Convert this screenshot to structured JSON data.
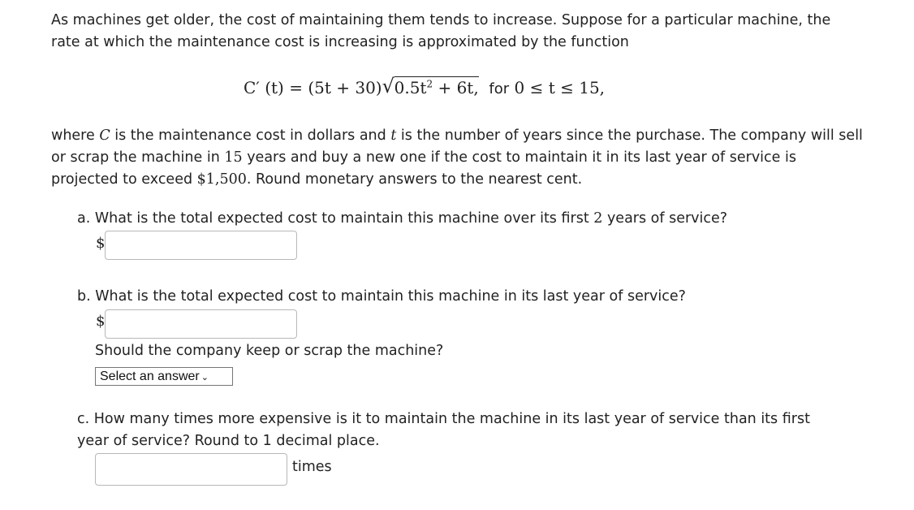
{
  "intro": "As machines get older, the cost of maintaining them tends to increase. Suppose for a particular machine, the rate at which the maintenance cost is increasing is approximated by the function",
  "formula": {
    "lhs": "C′ (t) = (5t + 30)",
    "radicand_a": "0.5t",
    "radicand_exp": "2",
    "radicand_b": " + 6t,",
    "domain_label": "for",
    "domain": "0 ≤ t ≤ 15,"
  },
  "context": {
    "part1": "where ",
    "C": "C",
    "part2": " is the maintenance cost in dollars and ",
    "t": "t",
    "part3": " is the number of years since the purchase. The company will sell or scrap the machine in ",
    "years": "15",
    "part4": " years and buy a new one if the cost to maintain it in its last year of service is projected to exceed ",
    "threshold": "$1,500",
    "part5": ". Round monetary answers to the nearest cent."
  },
  "questions": {
    "a": {
      "text_before": "a. What is the total expected cost to maintain this machine over its first ",
      "num": "2",
      "text_after": " years of service?",
      "currency": "$",
      "value": ""
    },
    "b": {
      "text": "b. What is the total expected cost to maintain this machine in its last year of service?",
      "currency": "$",
      "value": "",
      "sub_question": "Should the company keep or scrap the machine?",
      "select_value": "Select an answer"
    },
    "c": {
      "text": "c. How many times more expensive is it to maintain the machine in its last year of service than its first year of service? Round to 1 decimal place.",
      "value": "",
      "unit": "times"
    }
  }
}
